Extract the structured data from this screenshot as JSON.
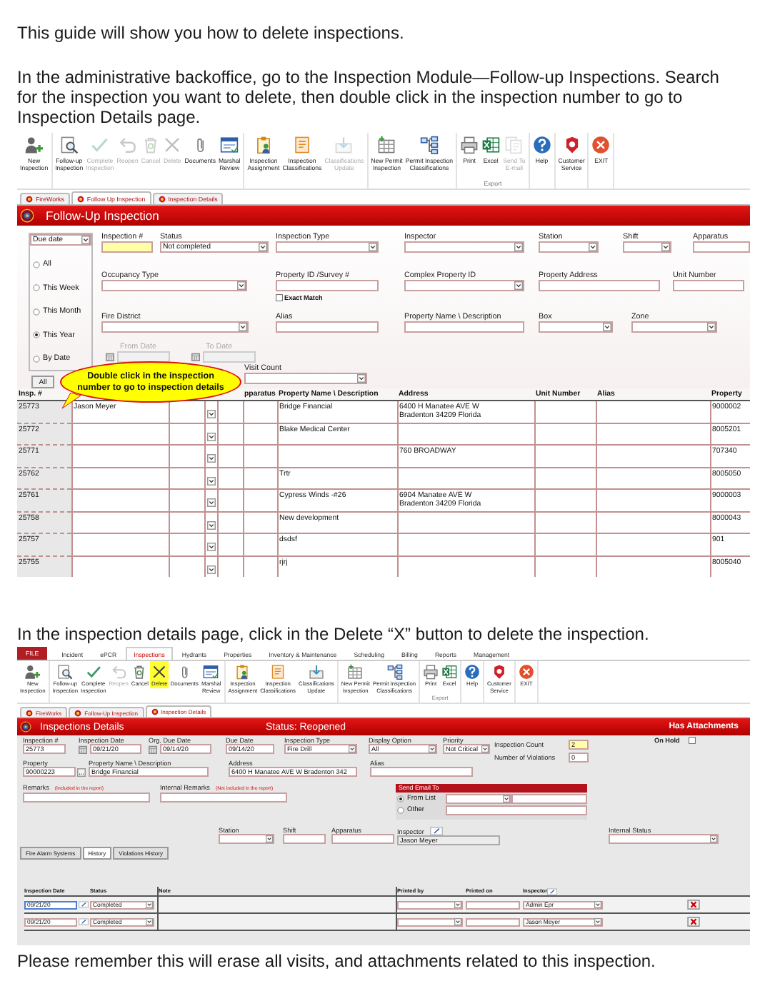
{
  "intro": [
    "This guide will show you how to delete inspections.",
    "In the administrative backoffice, go to the Inspection Module—Follow-up Inspections. Search for the inspection you want to delete, then double click in the inspection number to go to Inspection Details page."
  ],
  "screen_1": {
    "toolbar": {
      "groups": [
        {
          "buttons": [
            {
              "label": "New\nInspection",
              "kind": "person-add",
              "disabled": false
            }
          ]
        },
        {
          "buttons": [
            {
              "label": "Follow-up\nInspection",
              "kind": "magnifier",
              "disabled": false
            },
            {
              "label": "Complete\nInspection",
              "kind": "check",
              "disabled": true
            },
            {
              "label": "Reopen",
              "kind": "undo",
              "disabled": true
            },
            {
              "label": "Cancel",
              "kind": "trash",
              "disabled": true
            },
            {
              "label": "Delete",
              "kind": "cross",
              "disabled": true
            },
            {
              "label": "Documents",
              "kind": "clip",
              "disabled": false
            },
            {
              "label": "Marshal\nReview",
              "kind": "form",
              "disabled": false
            }
          ]
        },
        {
          "buttons": [
            {
              "label": "Inspection\nAssignment",
              "kind": "assign",
              "disabled": false
            },
            {
              "label": "Inspection\nClassifications",
              "kind": "classify",
              "disabled": false
            },
            {
              "label": "Classifications\nUpdate",
              "kind": "update",
              "disabled": true
            }
          ]
        },
        {
          "buttons": [
            {
              "label": "New Permit\nInspection",
              "kind": "table-add",
              "disabled": false
            },
            {
              "label": "Permit Inspection\nClassifications",
              "kind": "tree",
              "disabled": false
            }
          ]
        },
        {
          "label": "Export",
          "buttons": [
            {
              "label": "Print",
              "kind": "print",
              "disabled": false
            },
            {
              "label": "Excel",
              "kind": "excel",
              "disabled": false
            },
            {
              "label": "Send To\nE-mail",
              "kind": "email",
              "disabled": true
            }
          ]
        },
        {
          "buttons": [
            {
              "label": "Help",
              "kind": "help",
              "disabled": false
            }
          ]
        },
        {
          "buttons": [
            {
              "label": "Customer\nService",
              "kind": "service",
              "disabled": false
            }
          ]
        },
        {
          "buttons": [
            {
              "label": "EXIT",
              "kind": "exit",
              "disabled": false
            }
          ]
        }
      ]
    },
    "tabs": [
      {
        "label": "FireWorks",
        "selected": false
      },
      {
        "label": "Follow Up Inspection",
        "selected": true
      },
      {
        "label": "Inspection Details",
        "selected": false
      }
    ],
    "title": "Follow-Up Inspection",
    "date_type": "Due date",
    "ranges": [
      {
        "label": "All",
        "selected": false
      },
      {
        "label": "This Week",
        "selected": false
      },
      {
        "label": "This Month",
        "selected": false
      },
      {
        "label": "This Year",
        "selected": true
      },
      {
        "label": "By Date",
        "selected": false
      }
    ],
    "all_button": "All",
    "field_rows": [
      [
        {
          "label": "Inspection #",
          "kind": "highlight"
        },
        {
          "label": "Status",
          "kind": "select",
          "value": "Not completed"
        },
        {
          "label": "Inspection Type",
          "kind": "select"
        },
        {
          "label": "Inspector",
          "kind": "select"
        },
        {
          "label": "Station",
          "kind": "select"
        },
        {
          "label": "Shift",
          "kind": "select"
        },
        {
          "label": "Apparatus",
          "kind": "text"
        }
      ],
      [
        {
          "label": "Occupancy Type",
          "kind": "select"
        },
        {
          "label": "Property ID /Survey #",
          "kind": "text",
          "option": {
            "label": "Exact Match",
            "checked": false
          }
        },
        {
          "label": "Complex Property ID",
          "kind": "select"
        },
        {
          "label": "Property Address",
          "kind": "text"
        },
        {
          "label": "Unit Number",
          "kind": "text"
        }
      ],
      [
        {
          "label": "Fire District",
          "kind": "select"
        },
        {
          "label": "Alias",
          "kind": "text"
        },
        {
          "label": "Property Name \\ Description",
          "kind": "text"
        },
        {
          "label": "Box",
          "kind": "select"
        },
        {
          "label": "Zone",
          "kind": "select"
        }
      ],
      [
        {
          "label": "From Date",
          "kind": "date",
          "disabled": true
        },
        {
          "label": "To Date",
          "kind": "date",
          "disabled": true
        }
      ],
      [
        {
          "label": "Visit Count",
          "kind": "select"
        }
      ]
    ],
    "callout": "Double click in the inspection number to go to inspection details",
    "table": {
      "columns": {
        "insp": "Insp. #",
        "apparatus": "pparatus",
        "property_name": "Property Name \\ Description",
        "address": "Address",
        "unit_number": "Unit Number",
        "alias": "Alias",
        "property": "Property"
      },
      "rows": [
        {
          "insp": "25773",
          "inspector": "Jason Meyer",
          "property_name": "Bridge Financial",
          "address": "6400 H Manatee AVE W\nBradenton 34209 Florida",
          "property": "9000002"
        },
        {
          "insp": "25772",
          "property_name": "Blake Medical Center",
          "property": "8005201"
        },
        {
          "insp": "25771",
          "address": "760 BROADWAY",
          "property": "707340"
        },
        {
          "insp": "25762",
          "property_name": "Trtr",
          "property": "8005050"
        },
        {
          "insp": "25761",
          "property_name": "Cypress Winds -#26",
          "address": "6904 Manatee AVE W\nBradenton 34209 Florida",
          "property": "9000003"
        },
        {
          "insp": "25758",
          "property_name": "New development",
          "property": "8000043"
        },
        {
          "insp": "25757",
          "property_name": "dsdsf",
          "property": "901"
        },
        {
          "insp": "25755",
          "property_name": "rjrj",
          "property": "8005040"
        }
      ]
    }
  },
  "instruction": "In the inspection details page, click in the Delete “X” button to delete the inspection.",
  "screen_2": {
    "menu": [
      {
        "label": "FILE",
        "kind": "file",
        "selected": false
      },
      {
        "label": "Incident",
        "kind": "tab",
        "selected": false
      },
      {
        "label": "ePCR",
        "kind": "tab",
        "selected": false
      },
      {
        "label": "Inspections",
        "kind": "tab",
        "selected": true
      },
      {
        "label": "Hydrants",
        "kind": "tab",
        "selected": false
      },
      {
        "label": "Properties",
        "kind": "tab",
        "selected": false
      },
      {
        "label": "Inventory & Maintenance",
        "kind": "tab",
        "selected": false
      },
      {
        "label": "Scheduling",
        "kind": "tab",
        "selected": false
      },
      {
        "label": "Billing",
        "kind": "tab",
        "selected": false
      },
      {
        "label": "Reports",
        "kind": "tab",
        "selected": false
      },
      {
        "label": "Management",
        "kind": "tab",
        "selected": false
      }
    ],
    "toolbar": {
      "groups": [
        {
          "buttons": [
            {
              "label": "New\nInspection",
              "kind": "person-add",
              "disabled": false,
              "highlighted": false
            }
          ]
        },
        {
          "buttons": [
            {
              "label": "Follow-up\nInspection",
              "kind": "magnifier",
              "disabled": false,
              "highlighted": false
            },
            {
              "label": "Complete\nInspection",
              "kind": "check",
              "disabled": false,
              "highlighted": false
            },
            {
              "label": "Reopen",
              "kind": "undo",
              "disabled": true,
              "highlighted": false
            },
            {
              "label": "Cancel",
              "kind": "trash",
              "disabled": false,
              "highlighted": false
            },
            {
              "label": "Delete",
              "kind": "cross",
              "disabled": false,
              "highlighted": true
            },
            {
              "label": "Documents",
              "kind": "clip",
              "disabled": false,
              "highlighted": false
            },
            {
              "label": "Marshal\nReview",
              "kind": "form",
              "disabled": false,
              "highlighted": false
            }
          ]
        },
        {
          "buttons": [
            {
              "label": "Inspection\nAssignment",
              "kind": "assign",
              "disabled": false,
              "highlighted": false
            },
            {
              "label": "Inspection\nClassifications",
              "kind": "classify",
              "disabled": false,
              "highlighted": false
            },
            {
              "label": "Classifications\nUpdate",
              "kind": "update",
              "disabled": false,
              "highlighted": false
            }
          ]
        },
        {
          "buttons": [
            {
              "label": "New Permit\nInspection",
              "kind": "table-add",
              "disabled": false,
              "highlighted": false
            },
            {
              "label": "Permit Inspection\nClassifications",
              "kind": "tree",
              "disabled": false,
              "highlighted": false
            }
          ]
        },
        {
          "label": "Export",
          "buttons": [
            {
              "label": "Print",
              "kind": "print",
              "disabled": false,
              "highlighted": false
            },
            {
              "label": "Excel",
              "kind": "excel",
              "disabled": false,
              "highlighted": false
            }
          ]
        },
        {
          "buttons": [
            {
              "label": "Help",
              "kind": "help",
              "disabled": false,
              "highlighted": false
            }
          ]
        },
        {
          "buttons": [
            {
              "label": "Customer\nService",
              "kind": "service",
              "disabled": false,
              "highlighted": false
            }
          ]
        },
        {
          "buttons": [
            {
              "label": "EXIT",
              "kind": "exit",
              "disabled": false,
              "highlighted": false
            }
          ]
        }
      ]
    },
    "tabs": [
      {
        "label": "FireWorks",
        "selected": false
      },
      {
        "label": "Follow-Up Inspection",
        "selected": false
      },
      {
        "label": "Inspection Details",
        "selected": true
      }
    ],
    "title": "Inspections Details",
    "status": "Status: Reopened",
    "attachments": "Has Attachments",
    "field_rows": [
      [
        {
          "label": "Inspection #",
          "kind": "text",
          "value": "25773"
        },
        {
          "label": "Inspection Date",
          "kind": "date",
          "value": "09/21/20"
        },
        {
          "label": "Org. Due Date",
          "kind": "date",
          "value": "09/14/20"
        },
        {
          "label": "Due Date",
          "kind": "text",
          "value": "09/14/20"
        },
        {
          "label": "Inspection Type",
          "kind": "select",
          "value": "Fire Drill"
        },
        {
          "label": "Display Option",
          "kind": "select",
          "value": "All"
        },
        {
          "label": "Priority",
          "kind": "select",
          "value": "Not Critical"
        }
      ],
      [
        {
          "label": "Property",
          "kind": "lookup",
          "value": "90000223"
        },
        {
          "label": "Property Name \\ Description",
          "kind": "text",
          "value": "Bridge Financial"
        },
        {
          "label": "Address",
          "kind": "text",
          "value": "6400 H Manatee AVE W Bradenton 342"
        },
        {
          "label": "Alias",
          "kind": "text"
        }
      ],
      [
        {
          "label": "Station",
          "kind": "select"
        },
        {
          "label": "Shift",
          "kind": "text"
        },
        {
          "label": "Apparatus",
          "kind": "text"
        },
        {
          "label": "Inspector",
          "kind": "readonly",
          "value": "Jason Meyer",
          "edit": true
        },
        {
          "label": "Internal Status",
          "kind": "select"
        }
      ]
    ],
    "counts": [
      {
        "label": "Inspection Count",
        "value": "2",
        "highlighted": true
      },
      {
        "label": "Number of Violations",
        "value": "0",
        "highlighted": false
      }
    ],
    "on_hold": {
      "label": "On Hold",
      "checked": false
    },
    "remarks": [
      {
        "label": "Remarks",
        "note": "(Included in the report)"
      },
      {
        "label": "Internal Remarks",
        "note": "(Not included in the report)"
      }
    ],
    "email": {
      "title": "Send Email To",
      "options": [
        {
          "label": "From List",
          "selected": true
        },
        {
          "label": "Other",
          "selected": false
        }
      ]
    },
    "subtabs": [
      {
        "label": "Fire Alarm Systems",
        "selected": false
      },
      {
        "label": "History",
        "selected": true
      },
      {
        "label": "Violations History",
        "selected": false
      }
    ],
    "history": {
      "columns": [
        "Inspection Date",
        "Status",
        "Note",
        "Printed by",
        "Printed on",
        "Inspector"
      ],
      "rows": [
        {
          "date": "09/21/20",
          "status": "Completed",
          "inspector": "Admin  Epr",
          "selected": true
        },
        {
          "date": "09/21/20",
          "status": "Completed",
          "inspector": "Jason  Meyer",
          "selected": false
        }
      ]
    }
  },
  "closing": "Please remember this will erase all visits, and attachments related to this inspection."
}
